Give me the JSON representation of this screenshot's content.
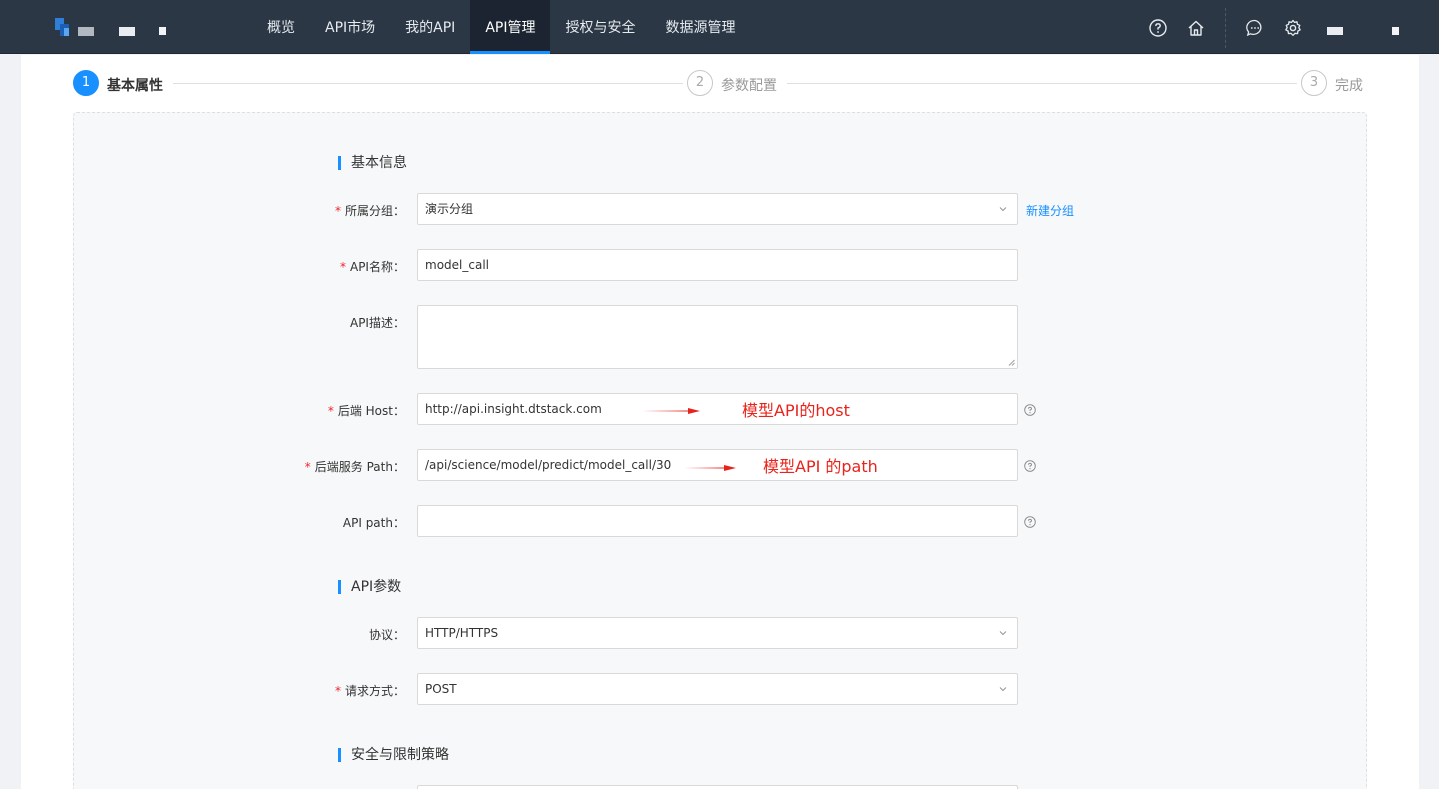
{
  "nav": {
    "items": [
      "概览",
      "API市场",
      "我的API",
      "API管理",
      "授权与安全",
      "数据源管理"
    ],
    "active_index": 3
  },
  "icons": {
    "logo": "logo-icon",
    "help": "help-circle-icon",
    "home": "home-icon",
    "message": "message-icon",
    "settings": "gear-icon"
  },
  "steps": [
    {
      "number": "1",
      "title": "基本属性",
      "status": "active"
    },
    {
      "number": "2",
      "title": "参数配置",
      "status": "wait"
    },
    {
      "number": "3",
      "title": "完成",
      "status": "wait"
    }
  ],
  "sections": {
    "basic": "基本信息",
    "api_params": "API参数",
    "security": "安全与限制策略"
  },
  "form": {
    "group": {
      "label": "所属分组",
      "value": "演示分组",
      "required": true,
      "new_group_link": "新建分组"
    },
    "api_name": {
      "label": "API名称",
      "value": "model_call",
      "required": true
    },
    "api_desc": {
      "label": "API描述",
      "value": "",
      "required": false
    },
    "backend_host": {
      "label": "后端 Host",
      "value": "http://api.insight.dtstack.com",
      "required": true
    },
    "backend_path": {
      "label": "后端服务 Path",
      "value": "/api/science/model/predict/model_call/30",
      "required": true
    },
    "api_path": {
      "label": "API path",
      "value": "",
      "required": false
    },
    "protocol": {
      "label": "协议",
      "value": "HTTP/HTTPS",
      "required": false
    },
    "method": {
      "label": "请求方式",
      "value": "POST",
      "required": true
    }
  },
  "colon": "：",
  "annotations": {
    "host_note": "模型API的host",
    "path_note": "模型API 的path"
  },
  "colors": {
    "primary": "#1890ff",
    "topbar": "#2b3745",
    "annotation": "#e8231b",
    "required": "#f5222d"
  }
}
